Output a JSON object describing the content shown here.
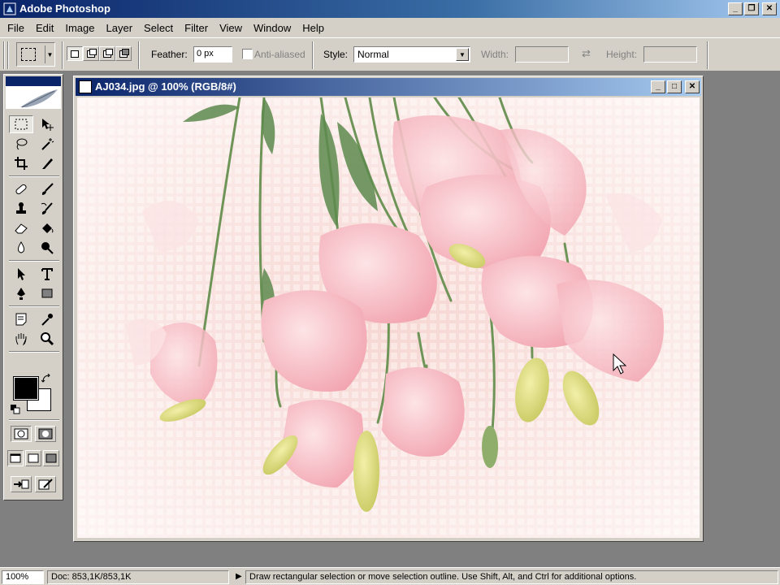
{
  "app": {
    "title": "Adobe Photoshop"
  },
  "window_buttons": {
    "minimize": "_",
    "restore": "❐",
    "close": "✕"
  },
  "menu": [
    "File",
    "Edit",
    "Image",
    "Layer",
    "Select",
    "Filter",
    "View",
    "Window",
    "Help"
  ],
  "options": {
    "feather_label": "Feather:",
    "feather_value": "0 px",
    "antialias_label": "Anti-aliased",
    "style_label": "Style:",
    "style_value": "Normal",
    "width_label": "Width:",
    "height_label": "Height:"
  },
  "document": {
    "title": "AJ034.jpg @ 100% (RGB/8#)"
  },
  "status": {
    "zoom": "100%",
    "doc_size": "Doc: 853,1K/853,1K",
    "message": "Draw rectangular selection or move selection outline.  Use Shift, Alt, and Ctrl for additional options."
  },
  "colors": {
    "title_start": "#0a246a",
    "title_end": "#a6caf0",
    "chrome": "#d4d0c8",
    "workspace": "#808080",
    "foreground": "#000000",
    "background": "#ffffff"
  }
}
